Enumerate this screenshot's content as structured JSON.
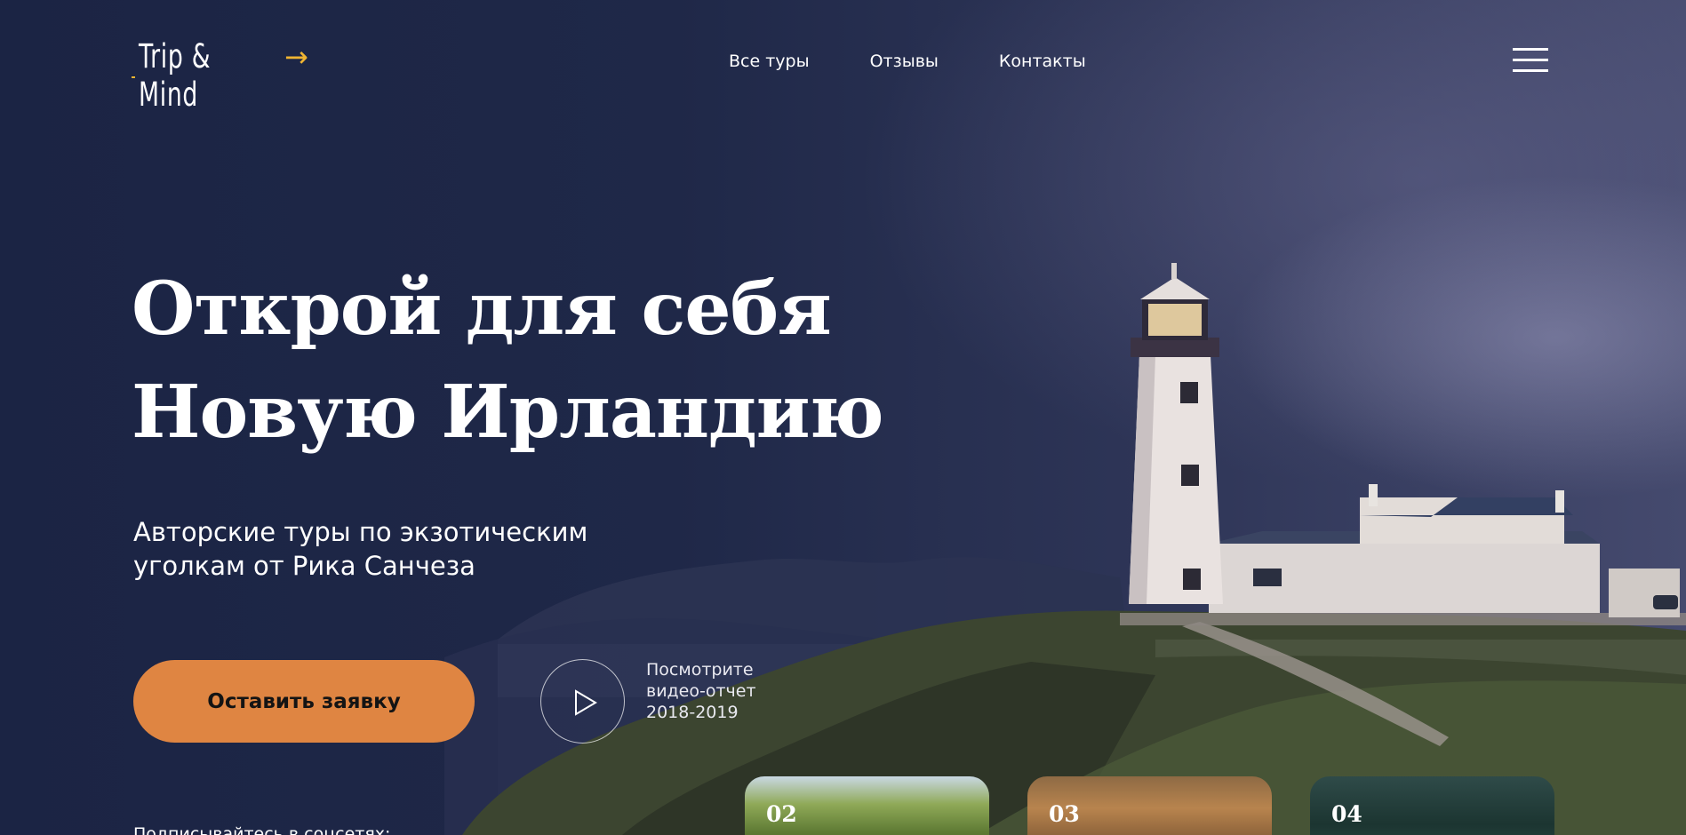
{
  "header": {
    "logo_text": "Trip & Mind",
    "logo_arrow": "→",
    "nav": [
      "Все туры",
      "Отзывы",
      "Контакты"
    ],
    "menu_icon": "hamburger-menu-icon"
  },
  "hero": {
    "title_line1": "Открой для себя",
    "title_line2": "Новую Ирландию",
    "subtitle": "Авторские туры по экзотическим уголкам от Рика Санчеза",
    "cta_label": "Оставить заявку",
    "video_note": "Посмотрите видео-отчет 2018-2019",
    "play_icon": "play-icon"
  },
  "subscribe_text": "Подписывайтесь в соцсетях:",
  "tour_cards": [
    "02",
    "03",
    "04"
  ],
  "colors": {
    "accent": "#df8542",
    "logo_accent": "#f0b432",
    "background": "#1d2440"
  }
}
